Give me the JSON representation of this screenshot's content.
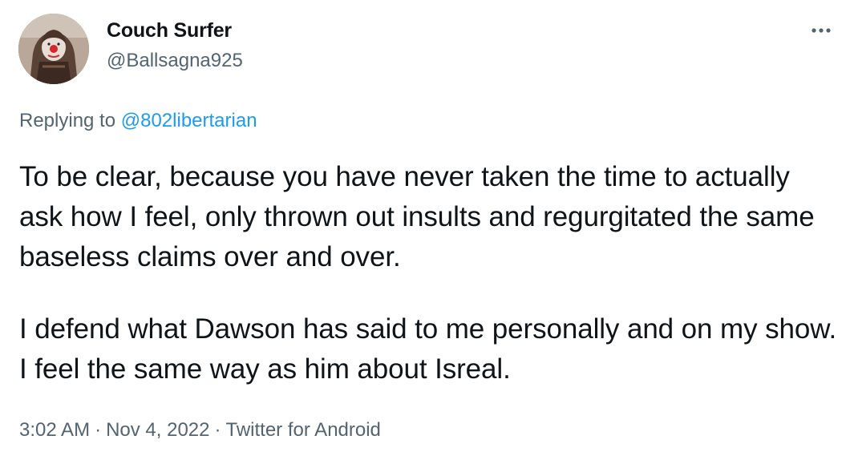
{
  "author": {
    "display_name": "Couch Surfer",
    "handle": "@Ballsagna925",
    "avatar_icon": "avatar-image"
  },
  "more_icon": "more-options-icon",
  "reply_context": {
    "prefix": "Replying to ",
    "mention": "@802libertarian"
  },
  "tweet": {
    "paragraphs": [
      "To be clear, because you have never taken the time to actually ask how I feel, only thrown out insults and regurgitated the same baseless claims over and over.",
      "I defend what Dawson has said to me personally and on my show. I feel the same way as him about Isreal."
    ]
  },
  "meta": {
    "time": "3:02 AM",
    "separator": "·",
    "date": "Nov 4, 2022",
    "source": "Twitter for Android"
  },
  "colors": {
    "text": "#0f1419",
    "secondary": "#536471",
    "link": "#1d9bf0"
  }
}
